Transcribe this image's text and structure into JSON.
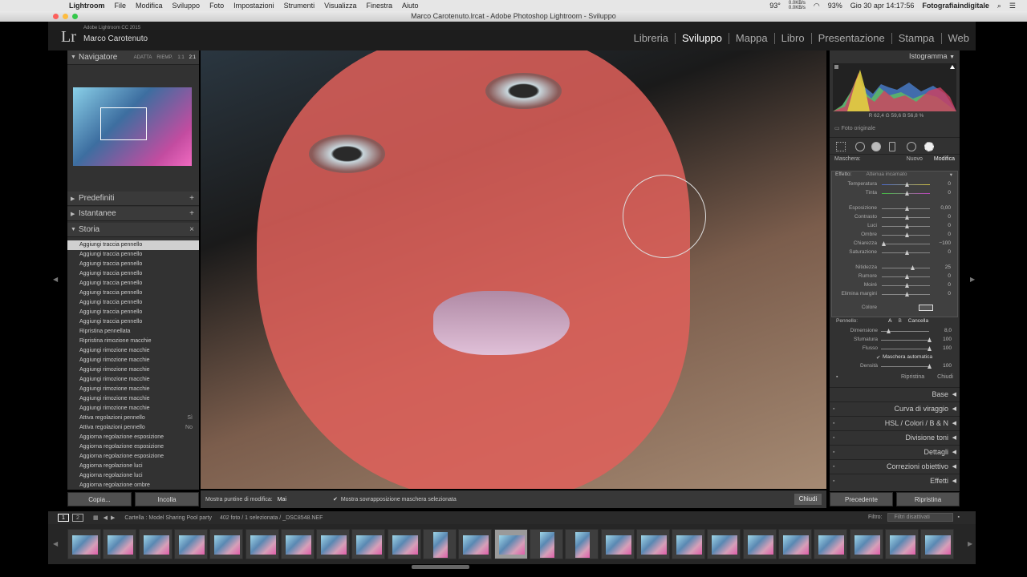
{
  "menubar": {
    "app": "Lightroom",
    "items": [
      "File",
      "Modifica",
      "Sviluppo",
      "Foto",
      "Impostazioni",
      "Strumenti",
      "Visualizza",
      "Finestra",
      "Aiuto"
    ],
    "temp": "93°",
    "net_up": "0.0KB/s",
    "net_down": "0.0KB/s",
    "battery": "93%",
    "clock": "Gio 30 apr  14:17:56",
    "user": "Fotografiaindigitale"
  },
  "window": {
    "title": "Marco Carotenuto.lrcat - Adobe Photoshop Lightroom - Sviluppo"
  },
  "identity": {
    "logo": "Lr",
    "version": "Adobe Lightroom CC 2015",
    "name": "Marco Carotenuto"
  },
  "modules": [
    "Libreria",
    "Sviluppo",
    "Mappa",
    "Libro",
    "Presentazione",
    "Stampa",
    "Web"
  ],
  "left": {
    "navigatore": "Navigatore",
    "nav_opts": [
      "ADATTA",
      "RIEMP.",
      "1:1",
      "2:1"
    ],
    "predefiniti": "Predefiniti",
    "istantanee": "Istantanee",
    "storia": "Storia",
    "history": [
      {
        "t": "Aggiungi traccia pennello",
        "v": ""
      },
      {
        "t": "Aggiungi traccia pennello",
        "v": ""
      },
      {
        "t": "Aggiungi traccia pennello",
        "v": ""
      },
      {
        "t": "Aggiungi traccia pennello",
        "v": ""
      },
      {
        "t": "Aggiungi traccia pennello",
        "v": ""
      },
      {
        "t": "Aggiungi traccia pennello",
        "v": ""
      },
      {
        "t": "Aggiungi traccia pennello",
        "v": ""
      },
      {
        "t": "Aggiungi traccia pennello",
        "v": ""
      },
      {
        "t": "Aggiungi traccia pennello",
        "v": ""
      },
      {
        "t": "Ripristina pennellata",
        "v": ""
      },
      {
        "t": "Ripristina rimozione macchie",
        "v": ""
      },
      {
        "t": "Aggiungi rimozione macchie",
        "v": ""
      },
      {
        "t": "Aggiungi rimozione macchie",
        "v": ""
      },
      {
        "t": "Aggiungi rimozione macchie",
        "v": ""
      },
      {
        "t": "Aggiungi rimozione macchie",
        "v": ""
      },
      {
        "t": "Aggiungi rimozione macchie",
        "v": ""
      },
      {
        "t": "Aggiungi rimozione macchie",
        "v": ""
      },
      {
        "t": "Aggiungi rimozione macchie",
        "v": ""
      },
      {
        "t": "Attiva regolazioni pennello",
        "v": "Sì"
      },
      {
        "t": "Attiva regolazioni pennello",
        "v": "No"
      },
      {
        "t": "Aggiorna regolazione esposizione",
        "v": ""
      },
      {
        "t": "Aggiorna regolazione esposizione",
        "v": ""
      },
      {
        "t": "Aggiorna regolazione esposizione",
        "v": ""
      },
      {
        "t": "Aggiorna regolazione luci",
        "v": ""
      },
      {
        "t": "Aggiorna regolazione luci",
        "v": ""
      },
      {
        "t": "Aggiorna regolazione ombre",
        "v": ""
      }
    ],
    "copia": "Copia...",
    "incolla": "Incolla"
  },
  "toolbar": {
    "label": "Mostra puntine di modifica:",
    "value": "Mai",
    "overlay": "Mostra sovrapposizione maschera selezionata",
    "chiudi": "Chiudi"
  },
  "right": {
    "istogramma": "Istogramma",
    "rgb": "R  62,4  G  59,6  B  56,8 %",
    "foto_orig": "Foto originale",
    "maschera": "Maschera:",
    "nuovo": "Nuovo",
    "modifica": "Modifica",
    "effetto": "Effetto:",
    "effetto_val": "Attenua incarnato",
    "sliders1": [
      {
        "l": "Temperatura",
        "v": "0",
        "p": 0.5
      },
      {
        "l": "Tinta",
        "v": "0",
        "p": 0.5
      }
    ],
    "sliders2": [
      {
        "l": "Esposizione",
        "v": "0,00",
        "p": 0.5
      },
      {
        "l": "Contrasto",
        "v": "0",
        "p": 0.5
      },
      {
        "l": "Luci",
        "v": "0",
        "p": 0.5
      },
      {
        "l": "Ombre",
        "v": "0",
        "p": 0.5
      },
      {
        "l": "Chiarezza",
        "v": "−100",
        "p": 0.0
      },
      {
        "l": "Saturazione",
        "v": "0",
        "p": 0.5
      }
    ],
    "sliders3": [
      {
        "l": "Nitidezza",
        "v": "25",
        "p": 0.62
      },
      {
        "l": "Rumore",
        "v": "0",
        "p": 0.5
      },
      {
        "l": "Moiré",
        "v": "0",
        "p": 0.5
      },
      {
        "l": "Elimina margini",
        "v": "0",
        "p": 0.5
      }
    ],
    "colore": "Colore",
    "pennello": "Pennello:",
    "brush_tabs": [
      "A",
      "B",
      "Cancella"
    ],
    "brush_sliders": [
      {
        "l": "Dimensione",
        "v": "8,0",
        "p": 0.12
      },
      {
        "l": "Sfumatura",
        "v": "100",
        "p": 1.0
      },
      {
        "l": "Flusso",
        "v": "100",
        "p": 1.0
      }
    ],
    "auto_mask": "Maschera automatica",
    "densita": {
      "l": "Densità",
      "v": "100",
      "p": 1.0
    },
    "ripristina": "Ripristina",
    "chiudi": "Chiudi",
    "sections": [
      "Base",
      "Curva di viraggio",
      "HSL  /  Colori  /  B & N",
      "Divisione toni",
      "Dettagli",
      "Correzioni obiettivo",
      "Effetti"
    ],
    "precedente": "Precedente",
    "ripristina_btn": "Ripristina"
  },
  "filmbar": {
    "pages": [
      "1",
      "2"
    ],
    "source": "Cartella : Model Sharing Pool party",
    "count": "402 foto / 1 selezionata / _DSC8548.NEF",
    "filtro": "Filtro:",
    "filtro_val": "Filtri disattivati"
  }
}
